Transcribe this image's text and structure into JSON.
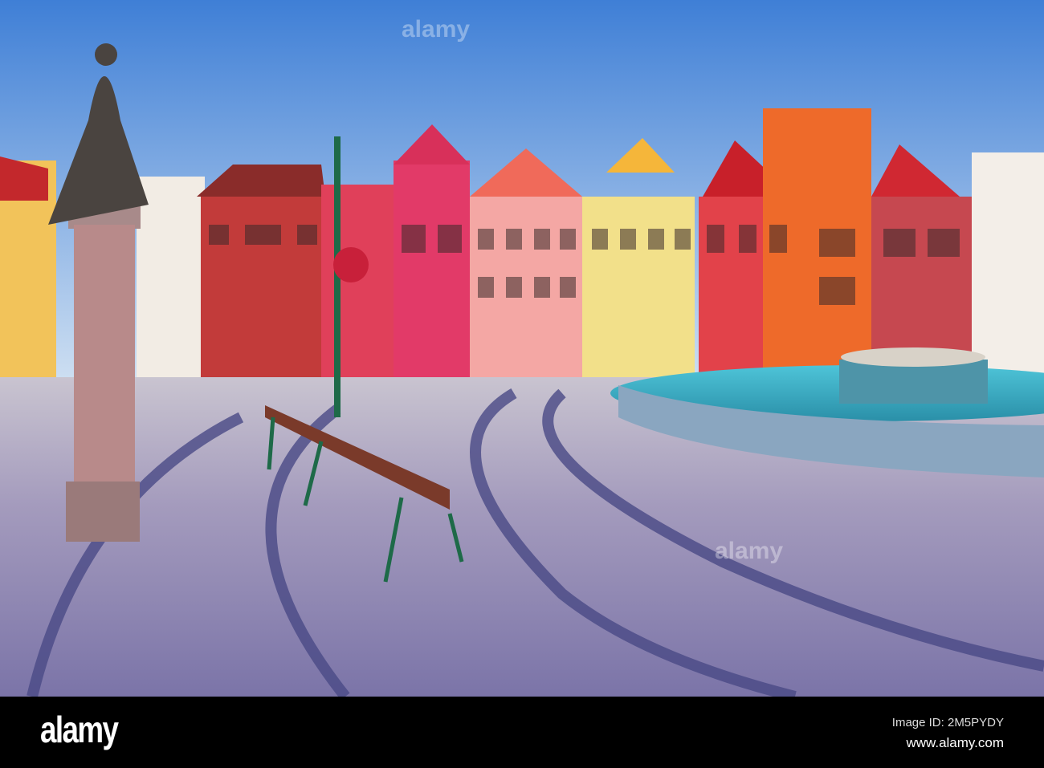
{
  "footer": {
    "logo": "alamy",
    "image_id": "Image ID: 2M5PYDY",
    "website": "www.alamy.com"
  },
  "watermark": "alamy",
  "colors": {
    "sky_top": "#3f7fd6",
    "sky_bottom": "#cfe0f2",
    "cobble": "#9a93b8",
    "footer": "#000000"
  }
}
